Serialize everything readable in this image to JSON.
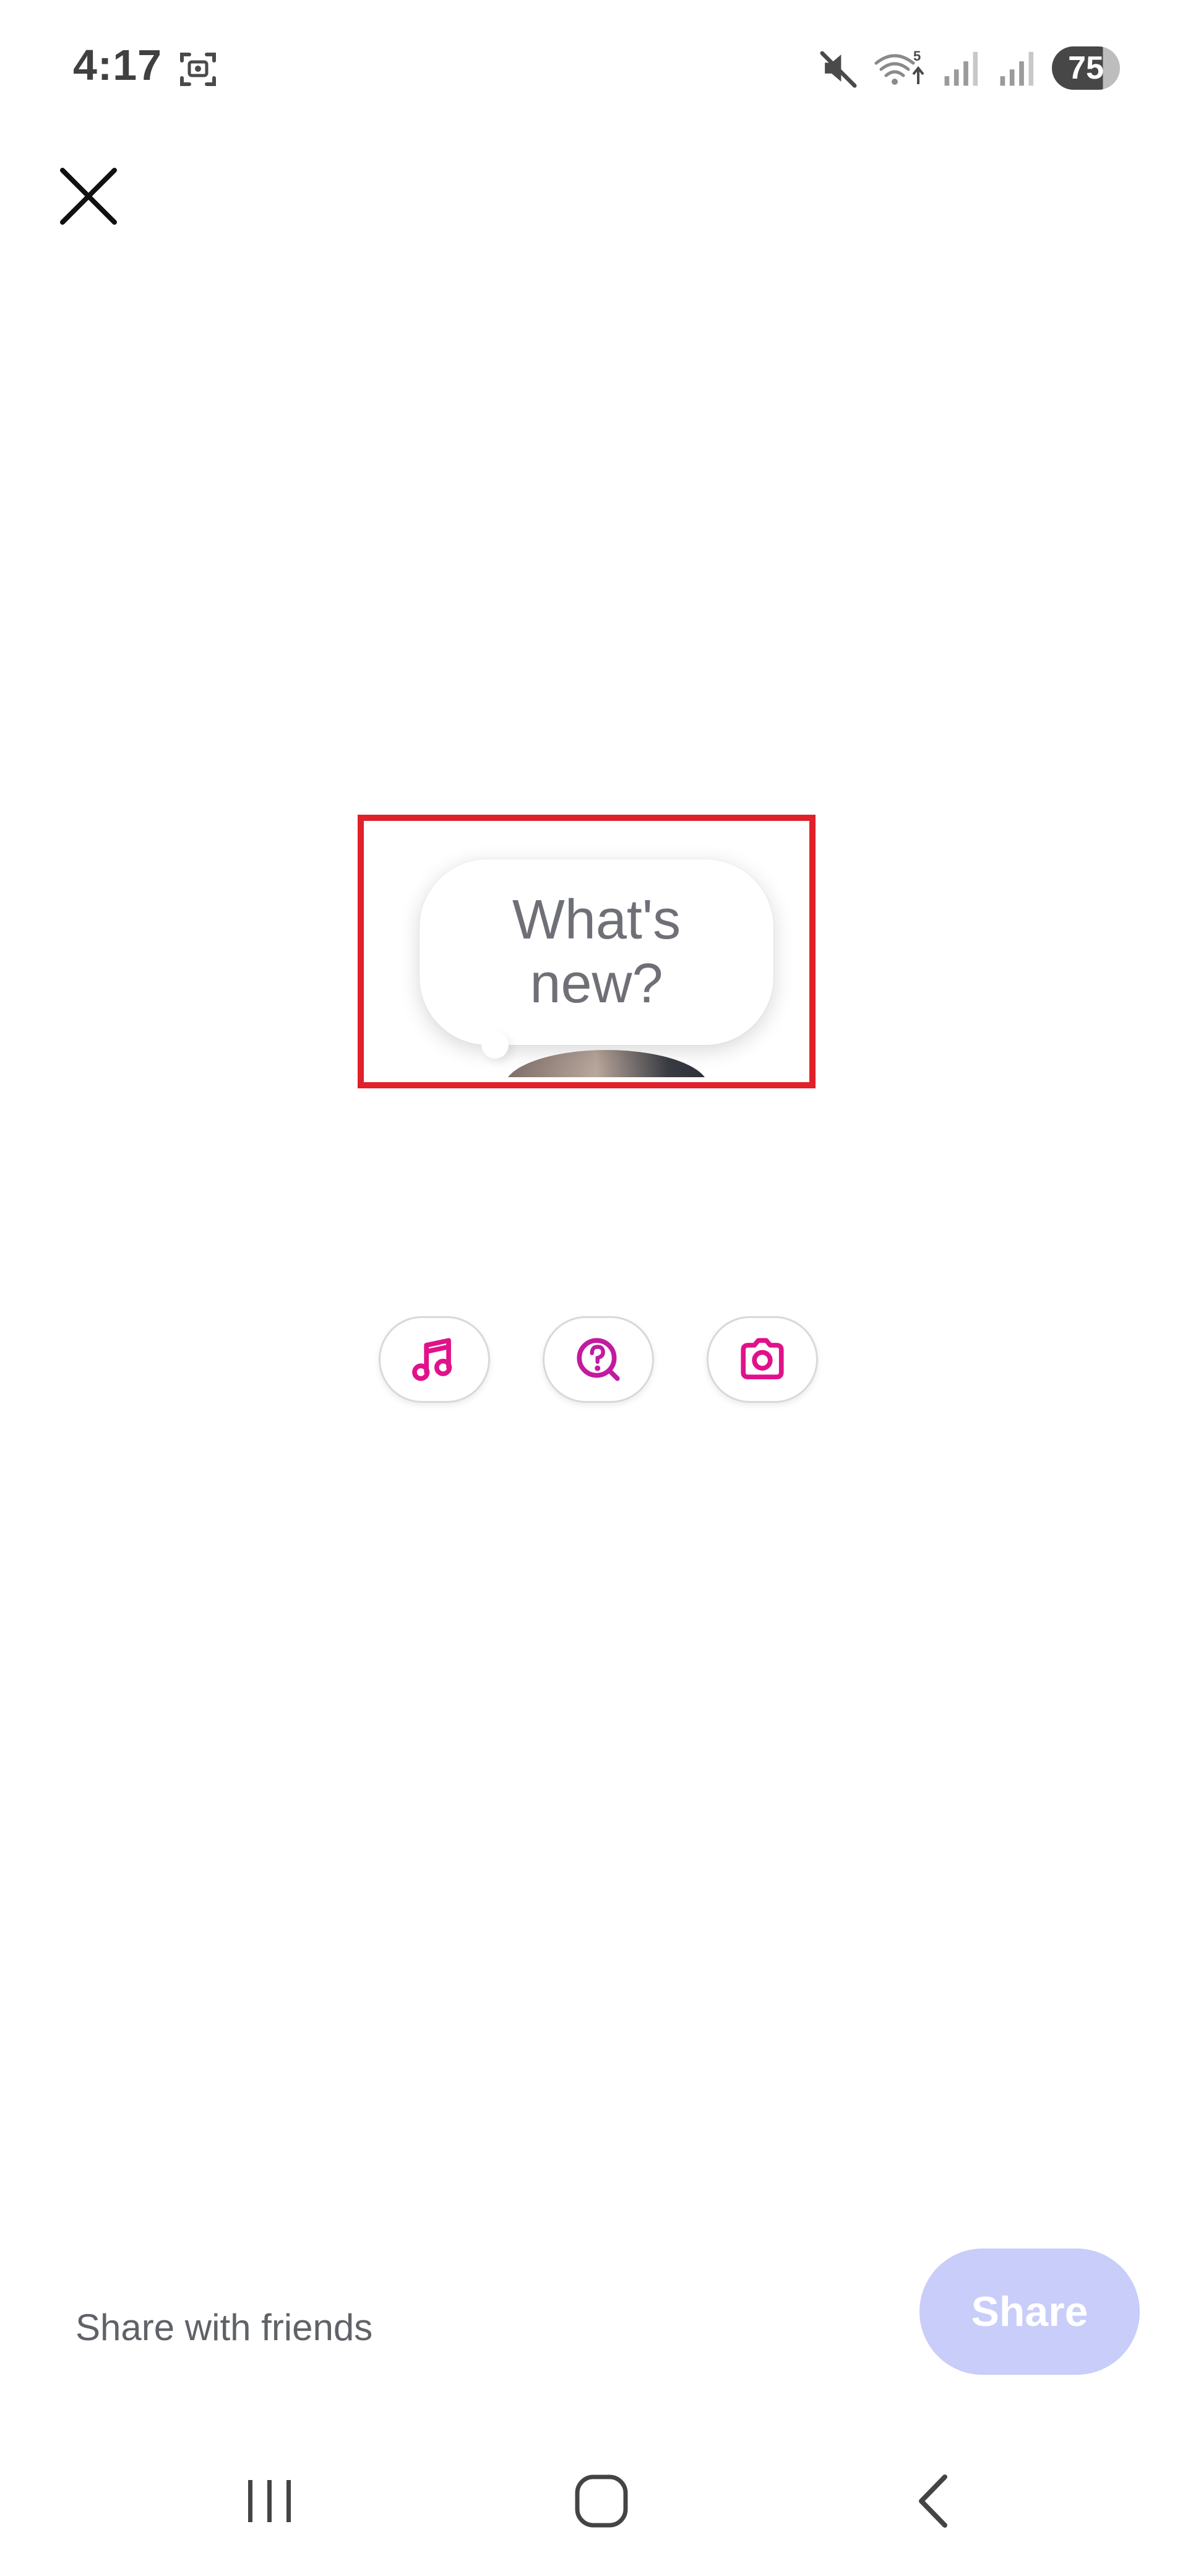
{
  "status_bar": {
    "time": "4:17",
    "battery": "75",
    "icons": [
      "screenshot-icon",
      "mute-icon",
      "wifi-icon",
      "signal-icon",
      "signal-icon"
    ]
  },
  "composer": {
    "placeholder": "What's new?"
  },
  "actions": [
    {
      "icon": "music-note-icon"
    },
    {
      "icon": "question-bubble-icon"
    },
    {
      "icon": "camera-icon"
    }
  ],
  "footer": {
    "audience": "Share with friends",
    "share_label": "Share"
  },
  "colors": {
    "accent": "#e0128a",
    "share_button_disabled": "#c8cdf9",
    "highlight": "#e0202a",
    "placeholder_text": "#6f7077"
  },
  "navigation": [
    "recents-icon",
    "home-icon",
    "back-icon"
  ]
}
